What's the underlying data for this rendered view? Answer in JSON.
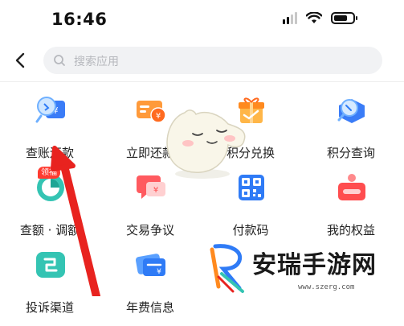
{
  "status_bar": {
    "time": "16:46"
  },
  "search": {
    "placeholder": "搜索应用"
  },
  "grid": [
    {
      "label": "查账还款",
      "icon": "bill-search-icon"
    },
    {
      "label": "立即还款",
      "icon": "repay-card-icon"
    },
    {
      "label": "积分兑换",
      "icon": "gift-exchange-icon"
    },
    {
      "label": "积分查询",
      "icon": "points-search-icon"
    },
    {
      "label": "查额 · 调额",
      "icon": "credit-limit-icon",
      "badge": "领福"
    },
    {
      "label": "交易争议",
      "icon": "dispute-chat-icon"
    },
    {
      "label": "付款码",
      "icon": "qr-code-icon"
    },
    {
      "label": "我的权益",
      "icon": "benefits-icon"
    },
    {
      "label": "投诉渠道",
      "icon": "complaint-channel-icon"
    },
    {
      "label": "年费信息",
      "icon": "annual-fee-icon"
    }
  ],
  "watermark": {
    "title": "安瑞手游网",
    "url": "www.szerg.com"
  },
  "colors": {
    "accent_blue": "#2f7bf6",
    "accent_red": "#ff4d4f",
    "accent_orange": "#ff8a1f",
    "arrow": "#e8231f"
  }
}
